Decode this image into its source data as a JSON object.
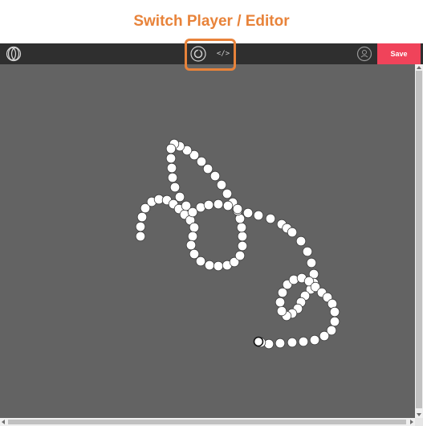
{
  "caption": {
    "title": "Switch Player / Editor"
  },
  "toolbar": {
    "logo_icon": "overlapping-circles-logo",
    "player_icon": "play-circle-icon",
    "editor_icon": "code-icon",
    "editor_glyph": "</>",
    "account_icon": "user-circle-icon",
    "save_label": "Save"
  },
  "colors": {
    "caption": "#e8833a",
    "highlight_border": "#e8833a",
    "toolbar_bg": "#2f2f2f",
    "canvas_bg": "#636363",
    "save_bg": "#f0435a",
    "dot_fill": "#ffffff"
  },
  "canvas": {
    "content": "trail of white circles forming a looping scribble"
  }
}
